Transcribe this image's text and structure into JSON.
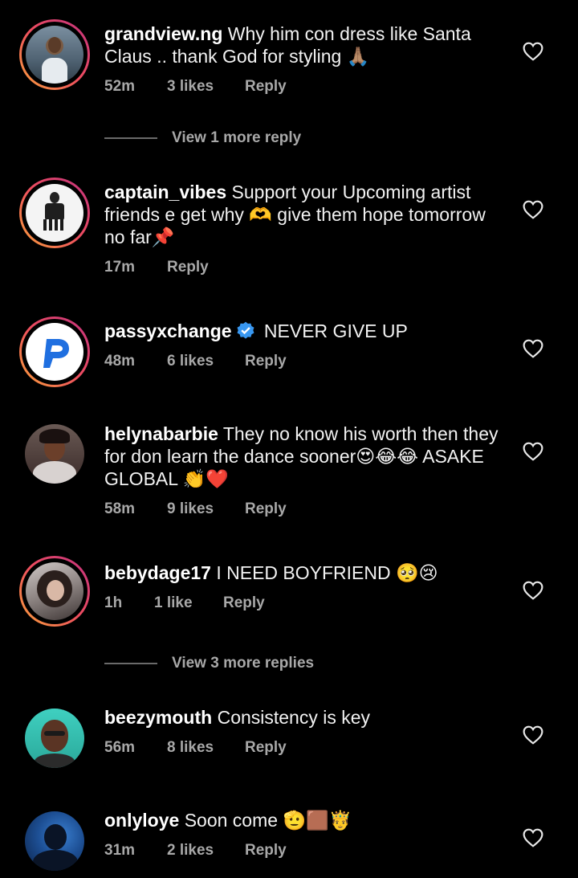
{
  "comments": [
    {
      "username": "grandview.ng",
      "text": " Why him con dress like Santa Claus .. thank God for styling 🙏🏽",
      "time": "52m",
      "likes": "3 likes",
      "reply": "Reply",
      "view_replies": "View 1 more reply",
      "avatar_icon": "profile-photo"
    },
    {
      "username": "captain_vibes",
      "text": " Support your Upcoming artist friends e get why 🫶 give them hope tomorrow no far📌",
      "time": "17m",
      "likes": "",
      "reply": "Reply",
      "avatar_icon": "profile-photo"
    },
    {
      "username": "passyxchange",
      "text": " NEVER GIVE UP",
      "time": "48m",
      "likes": "6 likes",
      "reply": "Reply",
      "verified": true,
      "avatar_icon": "brand-logo-p"
    },
    {
      "username": "helynabarbie",
      "text": " They no know his worth then they for don learn the dance sooner😍😂😂 ASAKE GLOBAL 👏❤️",
      "time": "58m",
      "likes": "9 likes",
      "reply": "Reply",
      "avatar_icon": "profile-photo"
    },
    {
      "username": "bebydage17",
      "text": " I NEED BOYFRIEND 🥺😢",
      "time": "1h",
      "likes": "1 like",
      "reply": "Reply",
      "view_replies": "View 3 more replies",
      "avatar_icon": "profile-photo"
    },
    {
      "username": "beezymouth",
      "text": " Consistency is key",
      "time": "56m",
      "likes": "8 likes",
      "reply": "Reply",
      "avatar_icon": "profile-photo"
    },
    {
      "username": "onlyloye",
      "text": " Soon come 🫡🟫🤴",
      "time": "31m",
      "likes": "2 likes",
      "reply": "Reply",
      "avatar_icon": "profile-photo"
    }
  ],
  "icons": {
    "like": "heart-outline-icon",
    "verified": "verified-badge-icon"
  },
  "colors": {
    "background": "#000000",
    "text": "#f2f2f2",
    "meta": "#a8a8a8",
    "story_ring_start": "#f9a33a",
    "story_ring_end": "#c1327f",
    "verified": "#3897f0"
  }
}
